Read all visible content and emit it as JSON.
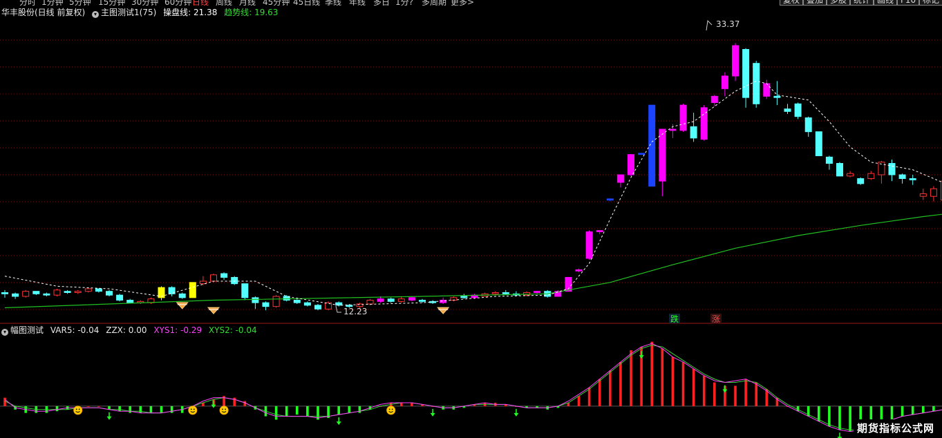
{
  "periods": [
    "分时",
    "1分钟",
    "5分钟",
    "15分钟",
    "30分钟",
    "60分钟",
    "日线",
    "周线",
    "月线",
    "45分钟",
    "45日线",
    "季线",
    "年线",
    "多日",
    "1分?",
    "多周期",
    "更多>"
  ],
  "toolbar_buttons": [
    "复权",
    "叠加",
    "多股",
    "统计",
    "画线",
    "F10",
    "标记"
  ],
  "main_header": {
    "stock": "华丰股份(日线 前复权)",
    "indicator": "主图测试1(75)",
    "line1_label": "操盘线:",
    "line1_value": "21.38",
    "line2_label": "趋势线:",
    "line2_value": "19.63"
  },
  "sub_header": {
    "indicator": "幅图测试",
    "var5_label": "VAR5:",
    "var5_value": "-0.04",
    "zzx_label": "ZZX:",
    "zzx_value": "0.00",
    "xys1_label": "XYS1:",
    "xys1_value": "-0.29",
    "xys2_label": "XYS2:",
    "xys2_value": "-0.04"
  },
  "labels": {
    "high": "33.37",
    "low": "12.23",
    "die": "跌",
    "zhang": "涨"
  },
  "watermark": "期货指标公式网",
  "colors": {
    "up": "#ff3333",
    "down": "#54ffff",
    "magenta": "#ff00ff",
    "yellow": "#ffff00",
    "blue": "#1a44ff",
    "ma": "#20c020",
    "dash": "#ffffff",
    "hist_up": "#ff2020",
    "hist_down": "#22ff22",
    "line_a": "#ff40ff",
    "line_b": "#40d040",
    "grid": "#7a1010",
    "bg": "#000000"
  },
  "chart_data": {
    "type": "candlestick",
    "ohlc": [
      [
        13.7,
        13.6,
        13.3,
        13.9
      ],
      [
        13.6,
        13.4,
        13.2,
        13.7
      ],
      [
        13.4,
        13.8,
        13.3,
        13.9
      ],
      [
        13.8,
        13.6,
        13.5,
        13.8
      ],
      [
        13.6,
        13.5,
        13.4,
        13.7
      ],
      [
        13.5,
        13.9,
        13.4,
        14.0
      ],
      [
        13.8,
        13.7,
        13.6,
        13.9
      ],
      [
        13.7,
        13.8,
        13.6,
        13.9
      ],
      [
        13.8,
        14.0,
        13.7,
        14.1
      ],
      [
        14.0,
        13.8,
        13.7,
        14.0
      ],
      [
        13.8,
        13.5,
        13.4,
        13.9
      ],
      [
        13.5,
        13.1,
        13.0,
        13.6
      ],
      [
        13.1,
        12.9,
        12.9,
        13.2
      ],
      [
        12.9,
        13.0,
        12.8,
        13.1
      ],
      [
        12.9,
        13.2,
        12.8,
        13.3
      ],
      [
        13.3,
        14.1,
        13.1,
        14.2
      ],
      [
        14.1,
        13.6,
        13.4,
        14.2
      ],
      [
        13.6,
        13.3,
        13.2,
        13.7
      ],
      [
        13.3,
        14.5,
        13.3,
        14.5
      ],
      [
        14.4,
        14.6,
        14.3,
        15.0
      ],
      [
        14.6,
        15.1,
        14.5,
        15.2
      ],
      [
        15.2,
        14.9,
        14.7,
        15.3
      ],
      [
        14.9,
        14.4,
        14.3,
        15.0
      ],
      [
        14.4,
        13.3,
        13.1,
        14.4
      ],
      [
        13.3,
        12.9,
        12.4,
        13.4
      ],
      [
        12.9,
        12.6,
        12.3,
        13.0
      ],
      [
        12.6,
        13.4,
        12.5,
        13.5
      ],
      [
        13.4,
        13.1,
        13.0,
        13.5
      ],
      [
        13.1,
        12.9,
        12.8,
        13.3
      ],
      [
        12.9,
        12.7,
        12.6,
        13.0
      ],
      [
        12.7,
        12.4,
        12.3,
        12.8
      ],
      [
        12.4,
        12.9,
        12.3,
        13.0
      ],
      [
        12.9,
        12.7,
        12.6,
        13.0
      ],
      [
        12.7,
        12.6,
        12.5,
        12.8
      ],
      [
        12.6,
        12.8,
        12.5,
        12.9
      ],
      [
        12.8,
        13.1,
        12.7,
        13.2
      ],
      [
        13.0,
        13.2,
        12.9,
        13.4
      ],
      [
        13.2,
        13.0,
        12.9,
        13.3
      ],
      [
        13.0,
        13.2,
        12.9,
        13.4
      ],
      [
        13.1,
        13.3,
        13.0,
        13.4
      ],
      [
        13.1,
        13.0,
        12.9,
        13.2
      ],
      [
        13.0,
        12.9,
        12.8,
        13.1
      ],
      [
        12.9,
        13.1,
        12.8,
        13.3
      ],
      [
        13.1,
        13.3,
        13.0,
        13.4
      ],
      [
        13.4,
        13.3,
        13.2,
        13.6
      ],
      [
        13.3,
        13.5,
        13.2,
        13.6
      ],
      [
        13.4,
        13.6,
        13.4,
        13.7
      ],
      [
        13.6,
        13.7,
        13.5,
        13.8
      ],
      [
        13.7,
        13.6,
        13.5,
        13.9
      ],
      [
        13.6,
        13.5,
        13.4,
        13.8
      ],
      [
        13.5,
        13.7,
        13.4,
        13.8
      ],
      [
        13.7,
        13.8,
        13.6,
        13.8
      ],
      [
        13.8,
        13.4,
        13.3,
        13.9
      ],
      [
        13.4,
        13.8,
        13.4,
        13.9
      ],
      [
        13.8,
        14.9,
        13.8,
        14.9
      ],
      [
        15.4,
        15.5,
        15.3,
        15.6
      ],
      [
        16.4,
        18.5,
        16.3,
        18.6
      ],
      [
        18.5,
        18.6,
        18.3,
        18.6
      ],
      [
        21.0,
        21.1,
        20.9,
        21.1
      ],
      [
        22.4,
        23.0,
        22.0,
        23.0
      ],
      [
        23.0,
        24.6,
        22.9,
        24.6
      ],
      [
        24.6,
        24.7,
        24.6,
        24.6
      ],
      [
        22.1,
        28.5,
        22.1,
        28.5
      ],
      [
        22.5,
        26.6,
        21.3,
        26.6
      ],
      [
        26.5,
        26.6,
        25.9,
        27.0
      ],
      [
        26.5,
        28.5,
        26.4,
        28.6
      ],
      [
        26.8,
        25.9,
        25.6,
        27.9
      ],
      [
        25.8,
        28.3,
        25.7,
        28.5
      ],
      [
        28.7,
        29.2,
        28.4,
        29.3
      ],
      [
        29.8,
        30.8,
        29.2,
        31.1
      ],
      [
        30.8,
        33.2,
        30.4,
        33.4
      ],
      [
        32.9,
        29.1,
        28.3,
        33.0
      ],
      [
        31.8,
        28.6,
        28.3,
        32.0
      ],
      [
        29.2,
        30.2,
        29.0,
        30.5
      ],
      [
        29.2,
        29.1,
        28.5,
        30.4
      ],
      [
        28.2,
        28.0,
        27.8,
        28.6
      ],
      [
        28.6,
        27.6,
        27.4,
        28.7
      ],
      [
        27.5,
        26.4,
        26.0,
        27.6
      ],
      [
        26.4,
        24.5,
        24.5,
        26.4
      ],
      [
        24.4,
        23.9,
        23.4,
        24.5
      ],
      [
        23.9,
        22.9,
        22.9,
        24.0
      ],
      [
        22.9,
        23.1,
        22.8,
        23.3
      ],
      [
        22.7,
        22.3,
        22.2,
        22.8
      ],
      [
        22.7,
        23.1,
        22.6,
        23.3
      ],
      [
        23.0,
        24.0,
        22.3,
        24.1
      ],
      [
        23.9,
        23.0,
        22.5,
        24.2
      ],
      [
        23.0,
        22.7,
        22.3,
        23.1
      ],
      [
        22.7,
        22.6,
        22.2,
        23.0
      ],
      [
        21.3,
        21.5,
        21.0,
        21.9
      ],
      [
        21.3,
        21.9,
        20.9,
        22.1
      ],
      [
        21.0,
        22.5,
        20.9,
        22.5
      ],
      [
        22.0,
        22.5,
        21.9,
        23.0
      ]
    ],
    "ohlc_order": [
      "open",
      "close",
      "low",
      "high"
    ],
    "y_range": [
      11.6,
      35.6
    ],
    "overlays": {
      "trend_dashed": [
        [
          0,
          15.0
        ],
        [
          5,
          14.2
        ],
        [
          10,
          14.0
        ],
        [
          15,
          13.4
        ],
        [
          20,
          14.6
        ],
        [
          24,
          14.6
        ],
        [
          27,
          13.4
        ],
        [
          32,
          12.7
        ],
        [
          40,
          12.9
        ],
        [
          47,
          13.4
        ],
        [
          52,
          13.5
        ],
        [
          54,
          14.0
        ],
        [
          56,
          16.0
        ],
        [
          58,
          19.5
        ],
        [
          60,
          22.8
        ],
        [
          62,
          25.6
        ],
        [
          64,
          26.8
        ],
        [
          66,
          27.2
        ],
        [
          68,
          28.4
        ],
        [
          70,
          29.6
        ],
        [
          72,
          30.4
        ],
        [
          73,
          30.2
        ],
        [
          74,
          29.3
        ],
        [
          77,
          28.9
        ],
        [
          79,
          27.2
        ],
        [
          81,
          25.2
        ],
        [
          83,
          24.0
        ],
        [
          85,
          23.7
        ],
        [
          87,
          23.4
        ],
        [
          89,
          22.7
        ],
        [
          91,
          22.0
        ]
      ],
      "ma_green": [
        [
          0,
          12.5
        ],
        [
          20,
          13.1
        ],
        [
          40,
          13.4
        ],
        [
          52,
          13.6
        ],
        [
          58,
          14.5
        ],
        [
          64,
          15.9
        ],
        [
          70,
          17.2
        ],
        [
          76,
          18.2
        ],
        [
          82,
          19.0
        ],
        [
          88,
          19.7
        ],
        [
          91,
          20.0
        ]
      ],
      "triangles_at": [
        [
          17,
          12.7
        ],
        [
          20,
          12.3
        ],
        [
          42,
          12.3
        ]
      ]
    },
    "sub_indicator": {
      "type": "histogram+lines",
      "values": [
        0.05,
        -0.02,
        -0.04,
        -0.04,
        -0.04,
        -0.03,
        -0.02,
        -0.01,
        0,
        0,
        -0.02,
        -0.03,
        -0.04,
        -0.04,
        -0.04,
        -0.04,
        -0.04,
        -0.04,
        -0.02,
        0.02,
        0.04,
        0.06,
        0.05,
        0.03,
        -0.02,
        -0.06,
        -0.08,
        -0.06,
        -0.05,
        -0.06,
        -0.08,
        -0.07,
        -0.05,
        -0.04,
        -0.04,
        -0.02,
        0,
        0.02,
        0.02,
        0.02,
        0.01,
        0,
        -0.02,
        -0.02,
        -0.01,
        0.01,
        0.02,
        0.02,
        0.01,
        0,
        -0.01,
        -0.01,
        -0.02,
        -0.01,
        0.02,
        0.06,
        0.11,
        0.16,
        0.21,
        0.26,
        0.33,
        0.35,
        0.38,
        0.34,
        0.29,
        0.26,
        0.22,
        0.18,
        0.14,
        0.12,
        0.12,
        0.16,
        0.14,
        0.1,
        0.05,
        0,
        -0.03,
        -0.06,
        -0.09,
        -0.12,
        -0.14,
        -0.15,
        -0.14,
        -0.12,
        -0.1,
        -0.08,
        -0.06,
        -0.05,
        -0.04,
        -0.03,
        -0.02,
        -0.02
      ],
      "line_a": [
        0.04,
        -0.01,
        -0.02,
        -0.03,
        -0.03,
        -0.02,
        -0.01,
        -0.01,
        -0.01,
        -0.01,
        -0.02,
        -0.03,
        -0.03,
        -0.04,
        -0.04,
        -0.04,
        -0.03,
        -0.02,
        0,
        0.03,
        0.05,
        0.05,
        0.04,
        0.02,
        -0.01,
        -0.04,
        -0.06,
        -0.06,
        -0.06,
        -0.06,
        -0.07,
        -0.06,
        -0.05,
        -0.04,
        -0.03,
        -0.01,
        0.01,
        0.02,
        0.02,
        0.02,
        0.01,
        0,
        -0.01,
        -0.01,
        0,
        0.01,
        0.02,
        0.01,
        0.01,
        0,
        -0.01,
        -0.01,
        -0.01,
        0,
        0.03,
        0.07,
        0.11,
        0.16,
        0.21,
        0.26,
        0.31,
        0.35,
        0.37,
        0.34,
        0.29,
        0.26,
        0.22,
        0.18,
        0.15,
        0.14,
        0.15,
        0.16,
        0.13,
        0.09,
        0.04,
        0,
        -0.03,
        -0.06,
        -0.09,
        -0.12,
        -0.14,
        -0.15,
        -0.14,
        -0.12,
        -0.1,
        -0.08,
        -0.06,
        -0.05,
        -0.04,
        -0.03,
        -0.02,
        -0.02
      ],
      "line_b": [
        0.03,
        0,
        -0.01,
        -0.02,
        -0.02,
        -0.02,
        -0.02,
        -0.01,
        -0.01,
        -0.01,
        -0.02,
        -0.02,
        -0.03,
        -0.03,
        -0.04,
        -0.04,
        -0.03,
        -0.02,
        0,
        0.02,
        0.04,
        0.05,
        0.04,
        0.02,
        -0.01,
        -0.03,
        -0.05,
        -0.06,
        -0.06,
        -0.06,
        -0.06,
        -0.06,
        -0.05,
        -0.04,
        -0.03,
        -0.02,
        0,
        0.01,
        0.02,
        0.02,
        0.01,
        0,
        -0.01,
        -0.01,
        0,
        0.01,
        0.01,
        0.01,
        0.01,
        0,
        -0.01,
        -0.01,
        -0.01,
        0,
        0.02,
        0.06,
        0.1,
        0.15,
        0.2,
        0.25,
        0.3,
        0.34,
        0.36,
        0.35,
        0.31,
        0.27,
        0.23,
        0.19,
        0.16,
        0.14,
        0.14,
        0.15,
        0.14,
        0.1,
        0.05,
        0.01,
        -0.02,
        -0.05,
        -0.08,
        -0.11,
        -0.13,
        -0.14,
        -0.14,
        -0.12,
        -0.1,
        -0.08,
        -0.06,
        -0.05,
        -0.04,
        -0.03,
        -0.02,
        -0.02
      ],
      "y_range": [
        -0.18,
        0.44
      ],
      "smileys_at": [
        7,
        18,
        21,
        37
      ],
      "arrows_at": [
        10,
        20,
        32,
        41,
        49,
        61,
        69,
        80
      ]
    }
  }
}
